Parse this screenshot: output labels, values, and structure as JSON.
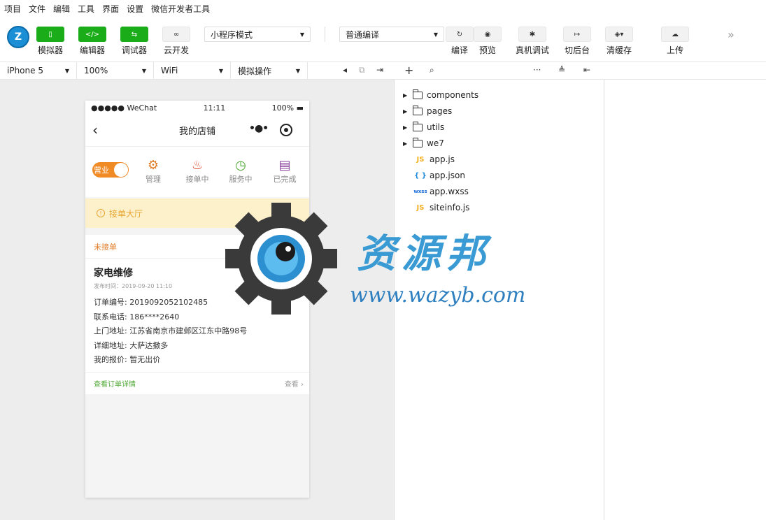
{
  "menu": [
    "项目",
    "文件",
    "编辑",
    "工具",
    "界面",
    "设置",
    "微信开发者工具"
  ],
  "toolbar": {
    "logo": "Z",
    "simulator": "模拟器",
    "editor": "编辑器",
    "debugger": "调试器",
    "cloud": "云开发",
    "mode_select": "小程序模式",
    "compile_select": "普通编译",
    "compile": "编译",
    "preview": "预览",
    "real_debug": "真机调试",
    "background": "切后台",
    "clear_cache": "清缓存",
    "upload": "上传"
  },
  "subbar": {
    "device": "iPhone 5",
    "zoom": "100%",
    "network": "WiFi",
    "operation": "模拟操作"
  },
  "phone": {
    "carrier": "●●●●● WeChat",
    "time": "11:11",
    "battery": "100%",
    "nav_title": "我的店铺",
    "toggle_label": "营业",
    "tabs": [
      {
        "label": "管理",
        "icon": "gear-icon",
        "color": "#e07b25"
      },
      {
        "label": "接单中",
        "icon": "fire-icon",
        "color": "#e0452b"
      },
      {
        "label": "服务中",
        "icon": "clock-icon",
        "color": "#4da832"
      },
      {
        "label": "已完成",
        "icon": "receipt-icon",
        "color": "#8a3e9e"
      }
    ],
    "notice": "接单大厅",
    "order": {
      "status": "未接单",
      "title": "家电维修",
      "time": "发布时间：2019-09-20 11:10",
      "lines": [
        "订单编号: 2019092052102485",
        "联系电话: 186****2640",
        "上门地址: 江苏省南京市建邺区江东中路98号",
        "详细地址: 大萨达撒多",
        "我的报价: 暂无出价"
      ],
      "detail_link": "查看订单详情",
      "view": "查看"
    }
  },
  "tree": [
    {
      "type": "folder",
      "name": "components"
    },
    {
      "type": "folder",
      "name": "pages"
    },
    {
      "type": "folder",
      "name": "utils"
    },
    {
      "type": "folder",
      "name": "we7"
    },
    {
      "type": "js",
      "badge": "JS",
      "name": "app.js"
    },
    {
      "type": "json",
      "badge": "{ }",
      "name": "app.json"
    },
    {
      "type": "wxss",
      "badge": "wxss",
      "name": "app.wxss"
    },
    {
      "type": "js",
      "badge": "JS",
      "name": "siteinfo.js"
    }
  ],
  "watermark": {
    "title": "资源邦",
    "url": "www.wazyb.com"
  }
}
